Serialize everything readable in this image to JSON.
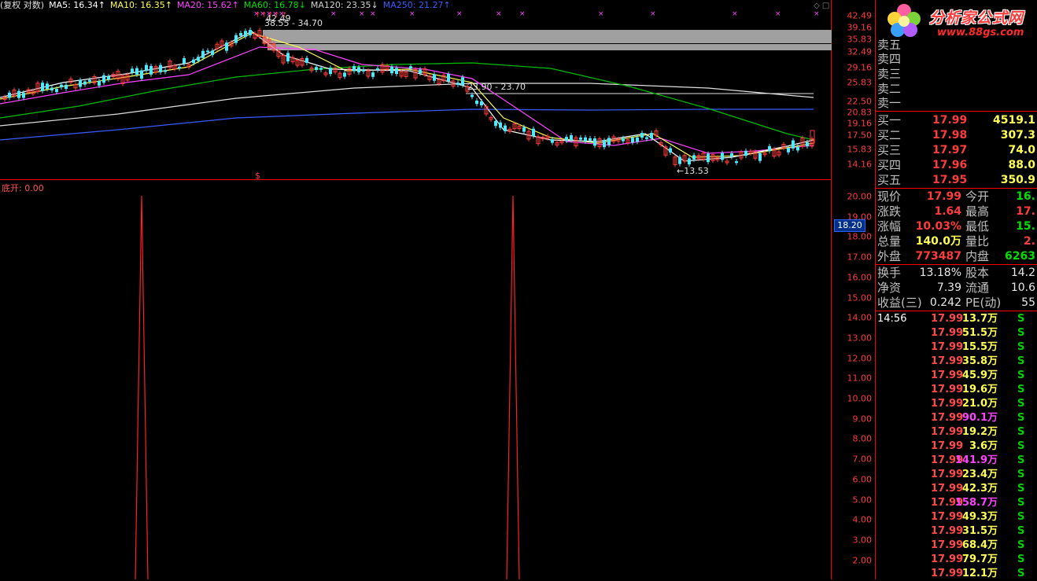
{
  "ma_bar": [
    {
      "label": "(复权 对数)",
      "color": "#e0e0e0"
    },
    {
      "label": "MA5: 16.34↑",
      "color": "#ffffff"
    },
    {
      "label": "MA10: 16.35↑",
      "color": "#ffff54"
    },
    {
      "label": "MA20: 15.62↑",
      "color": "#ff42ff"
    },
    {
      "label": "MA60: 16.78↓",
      "color": "#00e000"
    },
    {
      "label": "MA120: 23.35↓",
      "color": "#d0d0d0"
    },
    {
      "label": "MA250: 21.27↑",
      "color": "#3a5cff"
    }
  ],
  "price_axis": [
    "42.49",
    "39.16",
    "35.83",
    "32.49",
    "29.16",
    "25.83",
    "22.50",
    "20.83",
    "19.16",
    "17.50",
    "15.83",
    "14.16"
  ],
  "annotations": {
    "high_label": "42.49",
    "range_top": "38.55 - 34.70",
    "range_mid": "23.90 - 23.70",
    "low_label": "←13.53",
    "marker": "$"
  },
  "indicator": {
    "title": "底开: 0.00",
    "axis": [
      "20.00",
      "19.00",
      "18.00",
      "17.00",
      "16.00",
      "15.00",
      "14.00",
      "13.00",
      "12.00",
      "11.00",
      "10.00",
      "9.00",
      "8.00",
      "7.00",
      "6.00",
      "5.00",
      "4.00",
      "3.00",
      "2.00"
    ],
    "current_flag": "18.20"
  },
  "logo": {
    "text": "分析家公式网",
    "url": "www.88gs.com",
    "icon": "flower-logo-icon"
  },
  "sell_levels": [
    {
      "label": "卖五"
    },
    {
      "label": "卖四"
    },
    {
      "label": "卖三"
    },
    {
      "label": "卖二"
    },
    {
      "label": "卖一"
    }
  ],
  "buy_levels": [
    {
      "label": "买一",
      "price": "17.99",
      "vol": "4519.1"
    },
    {
      "label": "买二",
      "price": "17.98",
      "vol": "307.3"
    },
    {
      "label": "买三",
      "price": "17.97",
      "vol": "74.0"
    },
    {
      "label": "买四",
      "price": "17.96",
      "vol": "88.0"
    },
    {
      "label": "买五",
      "price": "17.95",
      "vol": "350.9"
    }
  ],
  "quote": [
    {
      "l1": "现价",
      "v1": "17.99",
      "c1": "red",
      "l2": "今开",
      "v2": "16.",
      "c2": "green"
    },
    {
      "l1": "涨跌",
      "v1": "1.64",
      "c1": "red",
      "l2": "最高",
      "v2": "17.",
      "c2": "red"
    },
    {
      "l1": "涨幅",
      "v1": "10.03%",
      "c1": "red",
      "l2": "最低",
      "v2": "15.",
      "c2": "green"
    },
    {
      "l1": "总量",
      "v1": "140.0万",
      "c1": "yellow",
      "l2": "量比",
      "v2": "2.",
      "c2": "red"
    },
    {
      "l1": "外盘",
      "v1": "773487",
      "c1": "red",
      "l2": "内盘",
      "v2": "6263",
      "c2": "green"
    }
  ],
  "stats": [
    {
      "l1": "换手",
      "v1": "13.18%",
      "l2": "股本",
      "v2": "14.2"
    },
    {
      "l1": "净资",
      "v1": "7.39",
      "l2": "流通",
      "v2": "10.6"
    },
    {
      "l1": "收益(三)",
      "v1": "0.242",
      "l2": "PE(动)",
      "v2": "55"
    }
  ],
  "trades": [
    {
      "time": "14:56",
      "price": "17.99",
      "vol": "13.7万",
      "color": "yellow",
      "side": "S"
    },
    {
      "time": "",
      "price": "17.99",
      "vol": "51.5万",
      "color": "yellow",
      "side": "S"
    },
    {
      "time": "",
      "price": "17.99",
      "vol": "15.5万",
      "color": "yellow",
      "side": "S"
    },
    {
      "time": "",
      "price": "17.99",
      "vol": "35.8万",
      "color": "yellow",
      "side": "S"
    },
    {
      "time": "",
      "price": "17.99",
      "vol": "45.9万",
      "color": "yellow",
      "side": "S"
    },
    {
      "time": "",
      "price": "17.99",
      "vol": "19.6万",
      "color": "yellow",
      "side": "S"
    },
    {
      "time": "",
      "price": "17.99",
      "vol": "21.0万",
      "color": "yellow",
      "side": "S"
    },
    {
      "time": "",
      "price": "17.99",
      "vol": "90.1万",
      "color": "magenta",
      "side": "S"
    },
    {
      "time": "",
      "price": "17.99",
      "vol": "19.2万",
      "color": "yellow",
      "side": "S"
    },
    {
      "time": "",
      "price": "17.99",
      "vol": "3.6万",
      "color": "yellow",
      "side": "S"
    },
    {
      "time": "",
      "price": "17.99",
      "vol": "141.9万",
      "color": "magenta",
      "side": "S"
    },
    {
      "time": "",
      "price": "17.99",
      "vol": "23.4万",
      "color": "yellow",
      "side": "S"
    },
    {
      "time": "",
      "price": "17.99",
      "vol": "42.3万",
      "color": "yellow",
      "side": "S"
    },
    {
      "time": "",
      "price": "17.99",
      "vol": "158.7万",
      "color": "magenta",
      "side": "S"
    },
    {
      "time": "",
      "price": "17.99",
      "vol": "49.3万",
      "color": "yellow",
      "side": "S"
    },
    {
      "time": "",
      "price": "17.99",
      "vol": "31.5万",
      "color": "yellow",
      "side": "S"
    },
    {
      "time": "",
      "price": "17.99",
      "vol": "68.4万",
      "color": "yellow",
      "side": "S"
    },
    {
      "time": "",
      "price": "17.99",
      "vol": "79.7万",
      "color": "yellow",
      "side": "S"
    },
    {
      "time": "",
      "price": "17.99",
      "vol": "12.1万",
      "color": "yellow",
      "side": "S"
    }
  ]
}
